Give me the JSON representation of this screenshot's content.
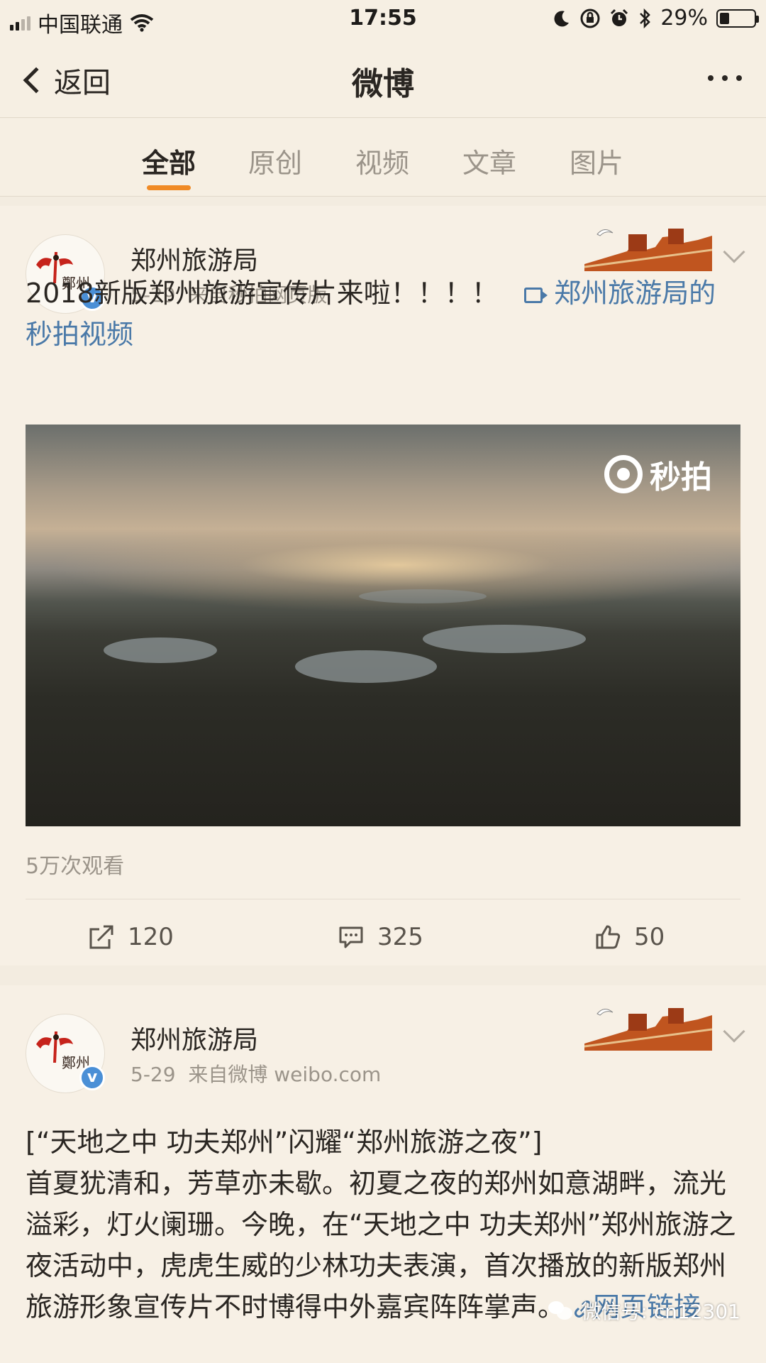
{
  "status_bar": {
    "carrier": "中国联通",
    "time": "17:55",
    "battery": "29%",
    "battery_level": 0.29
  },
  "nav": {
    "back_label": "返回",
    "title": "微博"
  },
  "tabs": [
    {
      "label": "全部",
      "active": true
    },
    {
      "label": "原创",
      "active": false
    },
    {
      "label": "视频",
      "active": false
    },
    {
      "label": "文章",
      "active": false
    },
    {
      "label": "图片",
      "active": false
    }
  ],
  "posts": [
    {
      "author": "郑州旅游局",
      "date": "5-29",
      "source": "来自秒拍网页版",
      "text": "2018新版郑州旅游宣传片来啦！！！！",
      "link_text": "郑州旅游局的秒拍视频",
      "video_brand": "秒拍",
      "views": "5万次观看",
      "reposts": "120",
      "comments": "325",
      "likes": "50"
    },
    {
      "author": "郑州旅游局",
      "date": "5-29",
      "source": "来自微博 weibo.com",
      "title": "[“天地之中 功夫郑州”闪耀“郑州旅游之夜”]",
      "body": "首夏犹清和，芳草亦未歇。初夏之夜的郑州如意湖畔，流光溢彩，灯火阑珊。今晚，在“天地之中 功夫郑州”郑州旅游之夜活动中，虎虎生威的少林功夫表演，首次播放的新版郑州旅游形象宣传片不时博得中外嘉宾阵阵掌声。",
      "link_text": "网页链接"
    }
  ],
  "avatar_brand": "鄭州",
  "watermark": "微信号: cn12301",
  "colors": {
    "accent": "#f08a25",
    "link": "#4a79a8",
    "background": "#f3ece0"
  }
}
